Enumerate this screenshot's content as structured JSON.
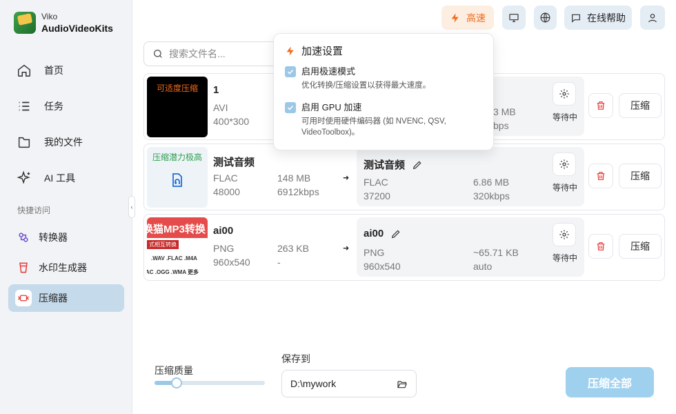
{
  "brand": {
    "sub": "Viko",
    "name": "AudioVideoKits"
  },
  "nav": [
    {
      "label": "首页",
      "icon": "home-icon"
    },
    {
      "label": "任务",
      "icon": "list-icon"
    },
    {
      "label": "我的文件",
      "icon": "folder-icon"
    },
    {
      "label": "AI 工具",
      "icon": "sparkle-icon"
    }
  ],
  "quick": {
    "title": "快捷访问",
    "items": [
      {
        "label": "转换器",
        "icon": "converter-icon"
      },
      {
        "label": "水印生成器",
        "icon": "watermark-icon"
      },
      {
        "label": "压缩器",
        "icon": "compressor-icon",
        "active": true
      }
    ]
  },
  "topbar": {
    "speed_label": "高速",
    "help_label": "在线帮助"
  },
  "search": {
    "placeholder": "搜索文件名..."
  },
  "popup": {
    "title": "加速设置",
    "options": [
      {
        "title": "启用极速模式",
        "desc": "优化转换/压缩设置以获得最大速度。",
        "checked": true
      },
      {
        "title": "启用 GPU 加速",
        "desc": "可用时使用硬件编码器 (如 NVENC, QSV, VideoToolbox)。",
        "checked": true
      }
    ]
  },
  "files": [
    {
      "badge": "可适度压缩",
      "name": "1",
      "format": "AVI",
      "resolution": "400*300",
      "size": "",
      "bitrate": "",
      "target": {
        "name": "",
        "format": "",
        "info": "",
        "size": "3 MB",
        "bitrate": "bps"
      },
      "status": "等待中",
      "compress_label": "压缩"
    },
    {
      "badge": "压缩潜力极高",
      "name": "测试音频",
      "format": "FLAC",
      "resolution": "48000",
      "size": "148 MB",
      "bitrate": "6912kbps",
      "target": {
        "name": "测试音频",
        "format": "FLAC",
        "info": "37200",
        "size": "6.86 MB",
        "bitrate": "320kbps"
      },
      "status": "等待中",
      "compress_label": "压缩"
    },
    {
      "badge": "",
      "name": "ai00",
      "format": "PNG",
      "resolution": "960x540",
      "size": "263 KB",
      "bitrate": "-",
      "thumb_text": "换猫MP3转换",
      "thumb_sub": "式相互转换",
      "thumb_formats": ".WAV .FLAC .M4A",
      "thumb_formats2": "AC .OGG .WMA 更多",
      "target": {
        "name": "ai00",
        "format": "PNG",
        "info": "960x540",
        "size": "~65.71 KB",
        "bitrate": "auto"
      },
      "status": "等待中",
      "compress_label": "压缩"
    }
  ],
  "bottom": {
    "quality_label": "压缩质量",
    "quality_value": 0.2,
    "save_label": "保存到",
    "save_path": "D:\\mywork",
    "compress_all": "压缩全部"
  },
  "colors": {
    "accent": "#9fd1ef",
    "speed": "#f26b1d",
    "danger": "#e53935"
  }
}
